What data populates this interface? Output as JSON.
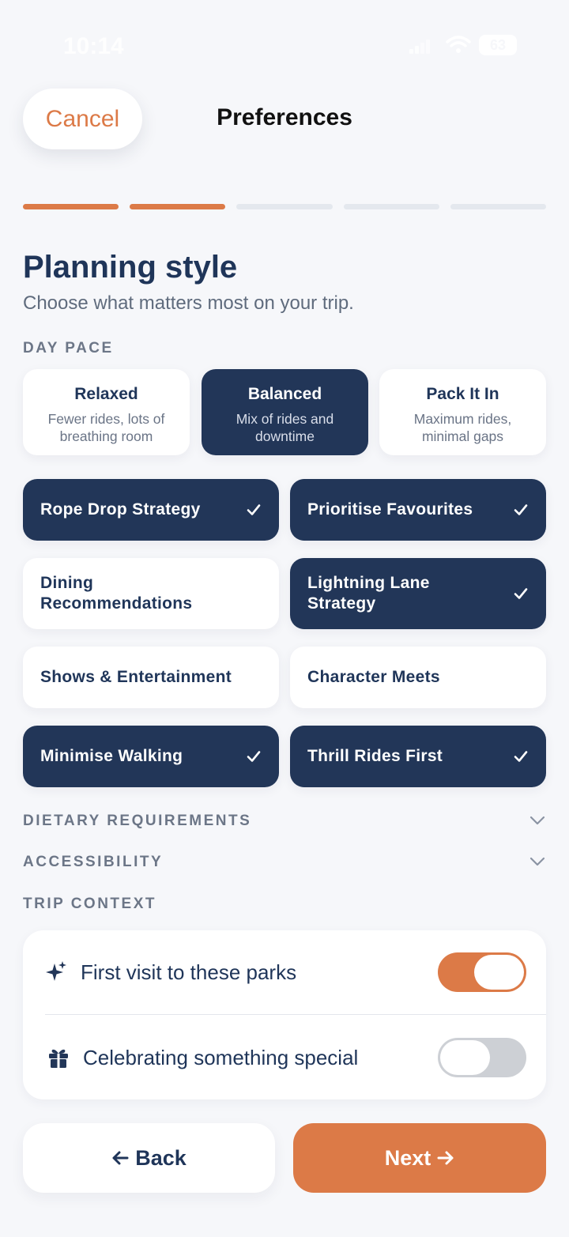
{
  "status_bar": {
    "time": "10:14",
    "battery": "63",
    "icons": [
      "bell-icon",
      "signal-icon",
      "wifi-icon",
      "battery-icon"
    ]
  },
  "header": {
    "cancel_label": "Cancel",
    "title": "Preferences"
  },
  "progress": {
    "total_steps": 5,
    "completed_steps": 2
  },
  "intro": {
    "heading": "Planning style",
    "subheading": "Choose what matters most on your trip."
  },
  "day_pace": {
    "label": "DAY PACE",
    "options": [
      {
        "title": "Relaxed",
        "desc": "Fewer rides, lots of breathing room",
        "selected": false
      },
      {
        "title": "Balanced",
        "desc": "Mix of rides and downtime",
        "selected": true
      },
      {
        "title": "Pack It In",
        "desc": "Maximum rides, minimal gaps",
        "selected": false
      }
    ]
  },
  "features": [
    {
      "label": "Rope Drop Strategy",
      "selected": true
    },
    {
      "label": "Prioritise Favourites",
      "selected": true
    },
    {
      "label": "Dining Recommendations",
      "selected": false
    },
    {
      "label": "Lightning Lane Strategy",
      "selected": true
    },
    {
      "label": "Shows & Entertainment",
      "selected": false
    },
    {
      "label": "Character Meets",
      "selected": false
    },
    {
      "label": "Minimise Walking",
      "selected": true
    },
    {
      "label": "Thrill Rides First",
      "selected": true
    }
  ],
  "sections": {
    "dietary": "DIETARY REQUIREMENTS",
    "accessibility": "ACCESSIBILITY",
    "trip_context": "TRIP CONTEXT"
  },
  "trip_context": [
    {
      "icon": "sparkle-icon",
      "label": "First visit to these parks",
      "enabled": true
    },
    {
      "icon": "gift-icon",
      "label": "Celebrating something special",
      "enabled": false
    }
  ],
  "footer": {
    "back_label": "Back",
    "next_label": "Next"
  },
  "colors": {
    "accent": "#dc7a47",
    "navy": "#223658",
    "background": "#f6f7fa"
  }
}
